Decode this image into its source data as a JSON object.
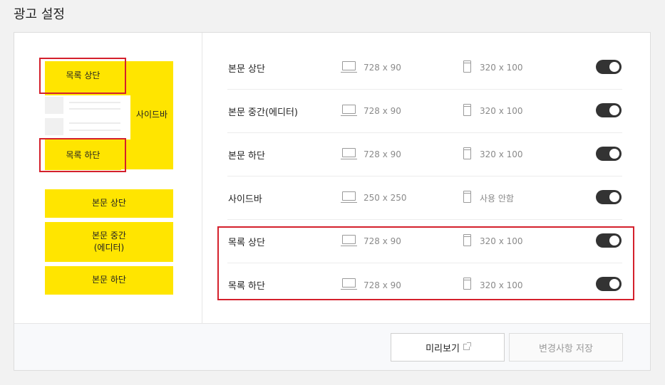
{
  "page": {
    "title": "광고 설정"
  },
  "diagram": {
    "list_top": "목록 상단",
    "list_bottom": "목록 하단",
    "sidebar": "사이드바",
    "body_top": "본문 상단",
    "body_middle": "본문 중간\n(에디터)",
    "body_bottom": "본문 하단"
  },
  "settings": {
    "rows": [
      {
        "label": "본문 상단",
        "pc_size": "728 x 90",
        "mobile_size": "320 x 100",
        "enabled": true
      },
      {
        "label": "본문 중간(에디터)",
        "pc_size": "728 x 90",
        "mobile_size": "320 x 100",
        "enabled": true
      },
      {
        "label": "본문 하단",
        "pc_size": "728 x 90",
        "mobile_size": "320 x 100",
        "enabled": true
      },
      {
        "label": "사이드바",
        "pc_size": "250 x 250",
        "mobile_size": "사용 안함",
        "enabled": true
      },
      {
        "label": "목록 상단",
        "pc_size": "728 x 90",
        "mobile_size": "320 x 100",
        "enabled": true
      },
      {
        "label": "목록 하단",
        "pc_size": "728 x 90",
        "mobile_size": "320 x 100",
        "enabled": true
      }
    ]
  },
  "footer": {
    "preview_label": "미리보기",
    "save_label": "변경사항 저장"
  },
  "colors": {
    "ad_yellow": "#ffe500",
    "highlight_red": "#d4202c",
    "toggle_on": "#333333"
  },
  "icons": {
    "pc": "monitor-icon",
    "mobile": "mobile-phone-icon",
    "external": "external-link-icon"
  }
}
